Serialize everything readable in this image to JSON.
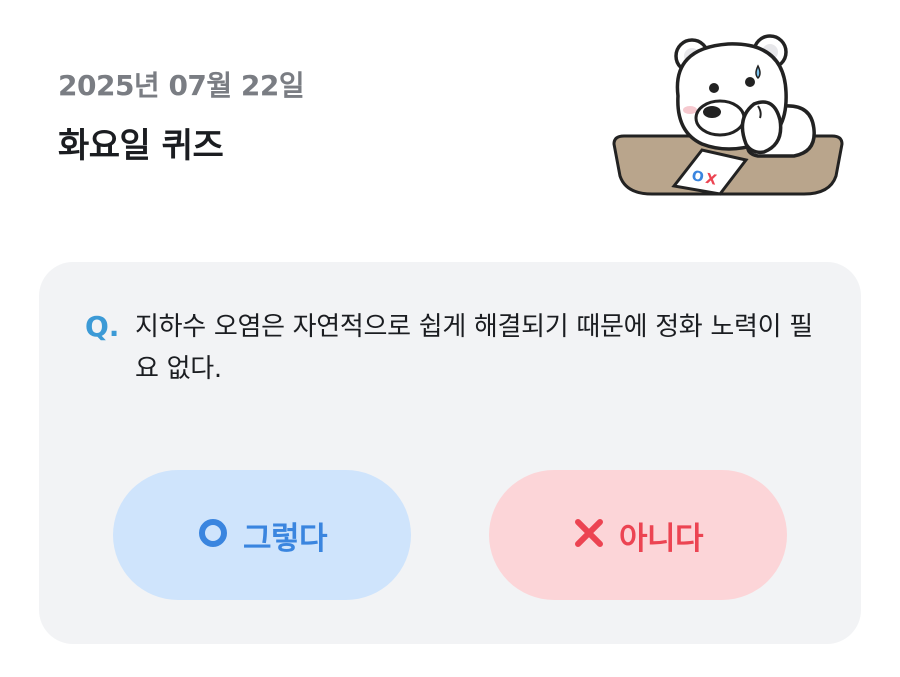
{
  "header": {
    "date": "2025년 07월 22일",
    "title": "화요일 퀴즈"
  },
  "mascot": {
    "icon": "polar-bear-thinking-icon",
    "paper_text": "OX"
  },
  "quiz": {
    "question_mark": "Q.",
    "question": "지하수 오염은 자연적으로 쉽게 해결되기 때문에 정화 노력이 필요 없다."
  },
  "answers": {
    "yes": {
      "label": "그렇다",
      "icon": "circle-o-icon",
      "color": "#3a85df",
      "bg": "#cfe4fc"
    },
    "no": {
      "label": "아니다",
      "icon": "x-mark-icon",
      "color": "#ec4452",
      "bg": "#fcd5d8"
    }
  }
}
